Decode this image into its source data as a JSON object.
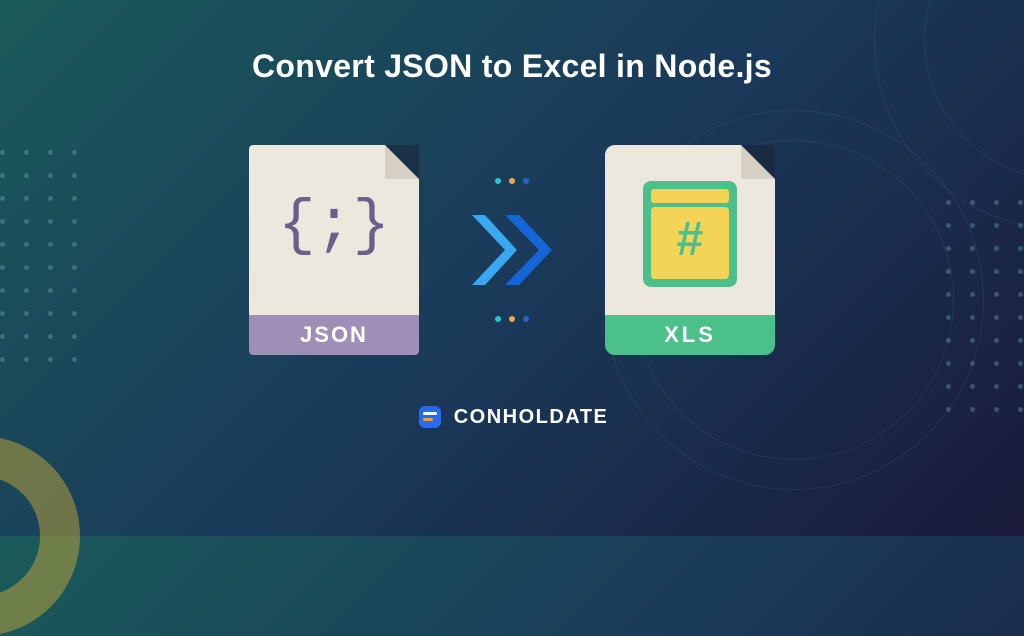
{
  "title": "Convert JSON to Excel in Node.js",
  "json_icon": {
    "symbol": "{;}",
    "label": "JSON"
  },
  "xls_icon": {
    "label": "XLS",
    "hash": "#"
  },
  "brand": {
    "name": "CONHOLDATE"
  },
  "colors": {
    "json_band": "#9d8fb5",
    "xls_band": "#4cc08a",
    "arrow_light": "#3aa8f0",
    "arrow_dark": "#1565d8"
  }
}
